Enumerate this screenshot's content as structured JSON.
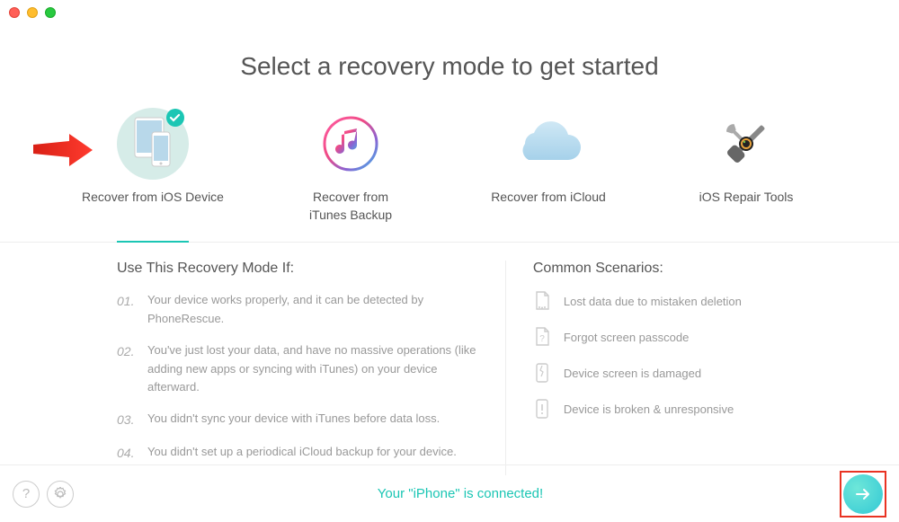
{
  "heading": "Select a recovery mode to get started",
  "modes": [
    {
      "label": "Recover from iOS Device",
      "active": true
    },
    {
      "label": "Recover from\niTunes Backup"
    },
    {
      "label": "Recover from iCloud"
    },
    {
      "label": "iOS Repair Tools"
    }
  ],
  "use_if_title": "Use This Recovery Mode If:",
  "use_if": [
    "Your device works properly, and it can be detected by PhoneRescue.",
    "You've just lost your data, and have no massive operations (like adding new apps or syncing with iTunes) on your device afterward.",
    "You didn't sync your device with iTunes before data loss.",
    "You didn't set up a periodical iCloud backup for your device."
  ],
  "scenarios_title": "Common Scenarios:",
  "scenarios": [
    "Lost data due to mistaken deletion",
    "Forgot screen passcode",
    "Device screen is damaged",
    "Device is broken & unresponsive"
  ],
  "status": "Your \"iPhone\" is connected!",
  "colors": {
    "accent": "#1bc6b4",
    "highlight": "#e93323"
  }
}
